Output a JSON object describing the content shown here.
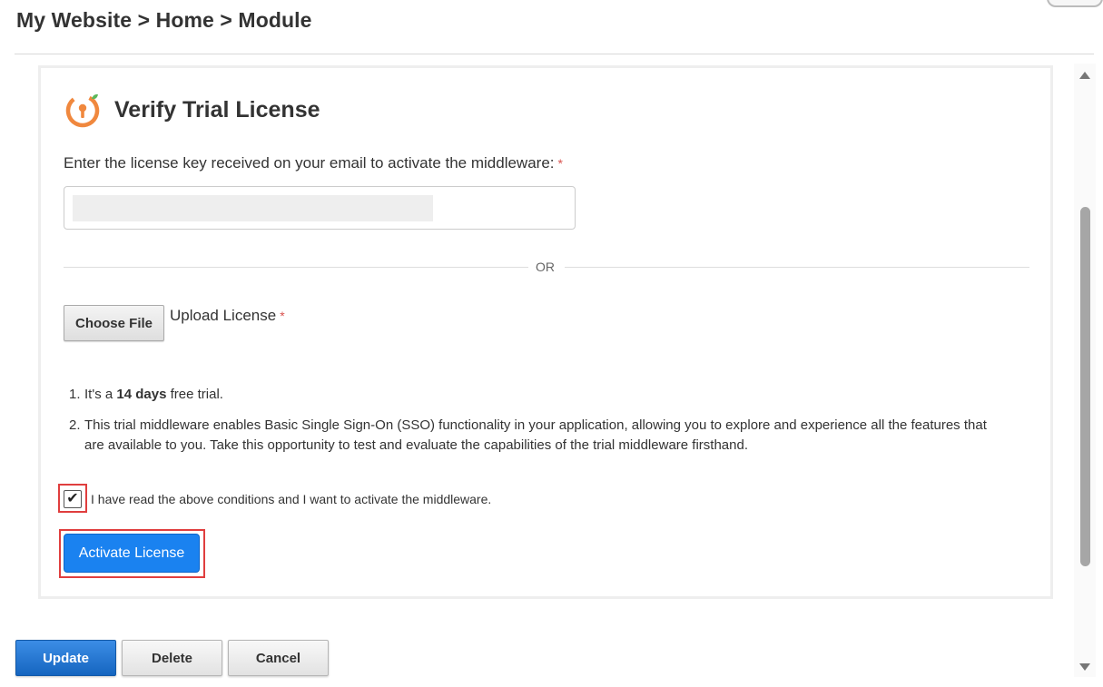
{
  "breadcrumb": "My Website > Home > Module",
  "panel": {
    "title": "Verify Trial License",
    "icon": "license-key-icon",
    "prompt_label": "Enter the license key received on your email to activate the middleware:",
    "required_mark": "*",
    "key_input_value": "",
    "divider_text": "OR",
    "choose_file_label": "Choose File",
    "upload_label": "Upload License",
    "terms": [
      {
        "num": "1.",
        "pre": "It's a ",
        "bold": "14 days",
        "post": " free trial."
      },
      {
        "num": "2.",
        "text": "This trial middleware enables Basic Single Sign-On (SSO) functionality in your application, allowing you to explore and experience all the features that are available to you. Take this opportunity to test and evaluate the capabilities of the trial middleware firsthand."
      }
    ],
    "checkbox_checked": true,
    "checkbox_mark": "✔",
    "checkbox_label": "I have read the above conditions and I want to activate the middleware.",
    "activate_label": "Activate License"
  },
  "footer": {
    "update_label": "Update",
    "delete_label": "Delete",
    "cancel_label": "Cancel"
  },
  "colors": {
    "accent": "#1a82f0",
    "highlight": "#e03e3e",
    "icon_orange": "#f0883e",
    "icon_green": "#5cb85c"
  }
}
